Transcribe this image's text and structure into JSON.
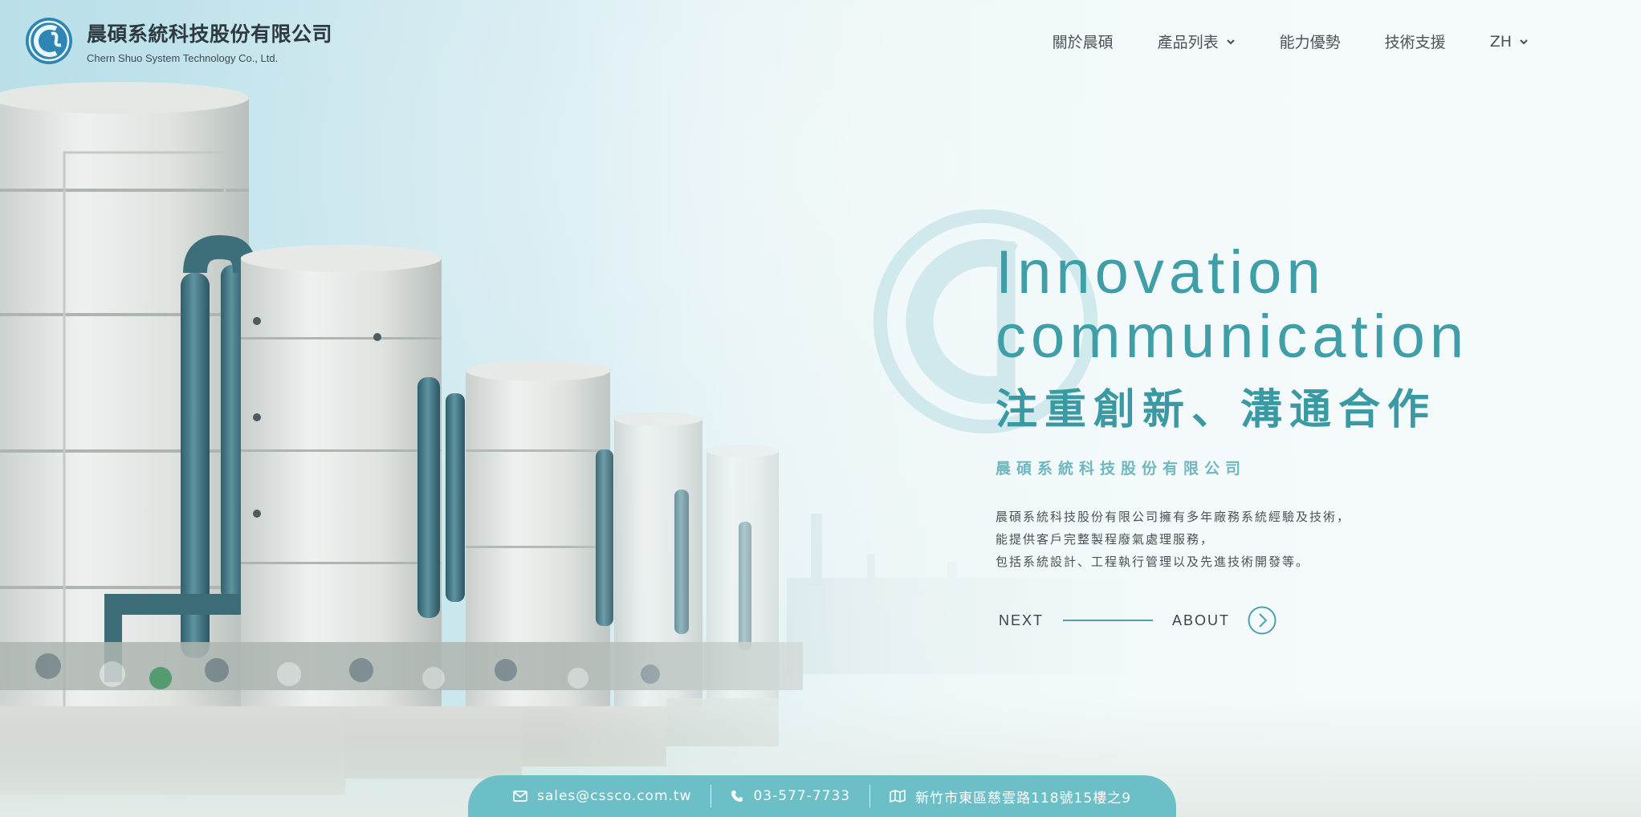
{
  "brand": {
    "name_zh": "晨碩系統科技股份有限公司",
    "name_en": "Chern Shuo System Technology Co., Ltd."
  },
  "nav": {
    "items": [
      {
        "label": "關於晨碩",
        "has_dropdown": false
      },
      {
        "label": "產品列表",
        "has_dropdown": true
      },
      {
        "label": "能力優勢",
        "has_dropdown": false
      },
      {
        "label": "技術支援",
        "has_dropdown": false
      },
      {
        "label": "ZH",
        "has_dropdown": true
      }
    ]
  },
  "hero": {
    "title_en_line1": "Innovation",
    "title_en_line2": "communication",
    "title_zh": "注重創新、溝通合作",
    "company": "晨碩系統科技股份有限公司",
    "desc_line1": "晨碩系統科技股份有限公司擁有多年廠務系統經驗及技術，",
    "desc_line2": "能提供客戶完整製程廢氣處理服務，",
    "desc_line3": "包括系統設計、工程執行管理以及先進技術開發等。",
    "next_label": "NEXT",
    "about_label": "ABOUT"
  },
  "contact": {
    "email": "sales@cssco.com.tw",
    "phone": "03-577-7733",
    "address": "新竹市東區慈雲路118號15樓之9"
  },
  "colors": {
    "accent": "#3f9ea7",
    "accent_light": "#6cbfc6",
    "text_dark": "#2e3a40"
  },
  "icons": {
    "email": "envelope-icon",
    "phone": "phone-icon",
    "address": "map-icon",
    "about": "chevron-right-circle-icon"
  }
}
